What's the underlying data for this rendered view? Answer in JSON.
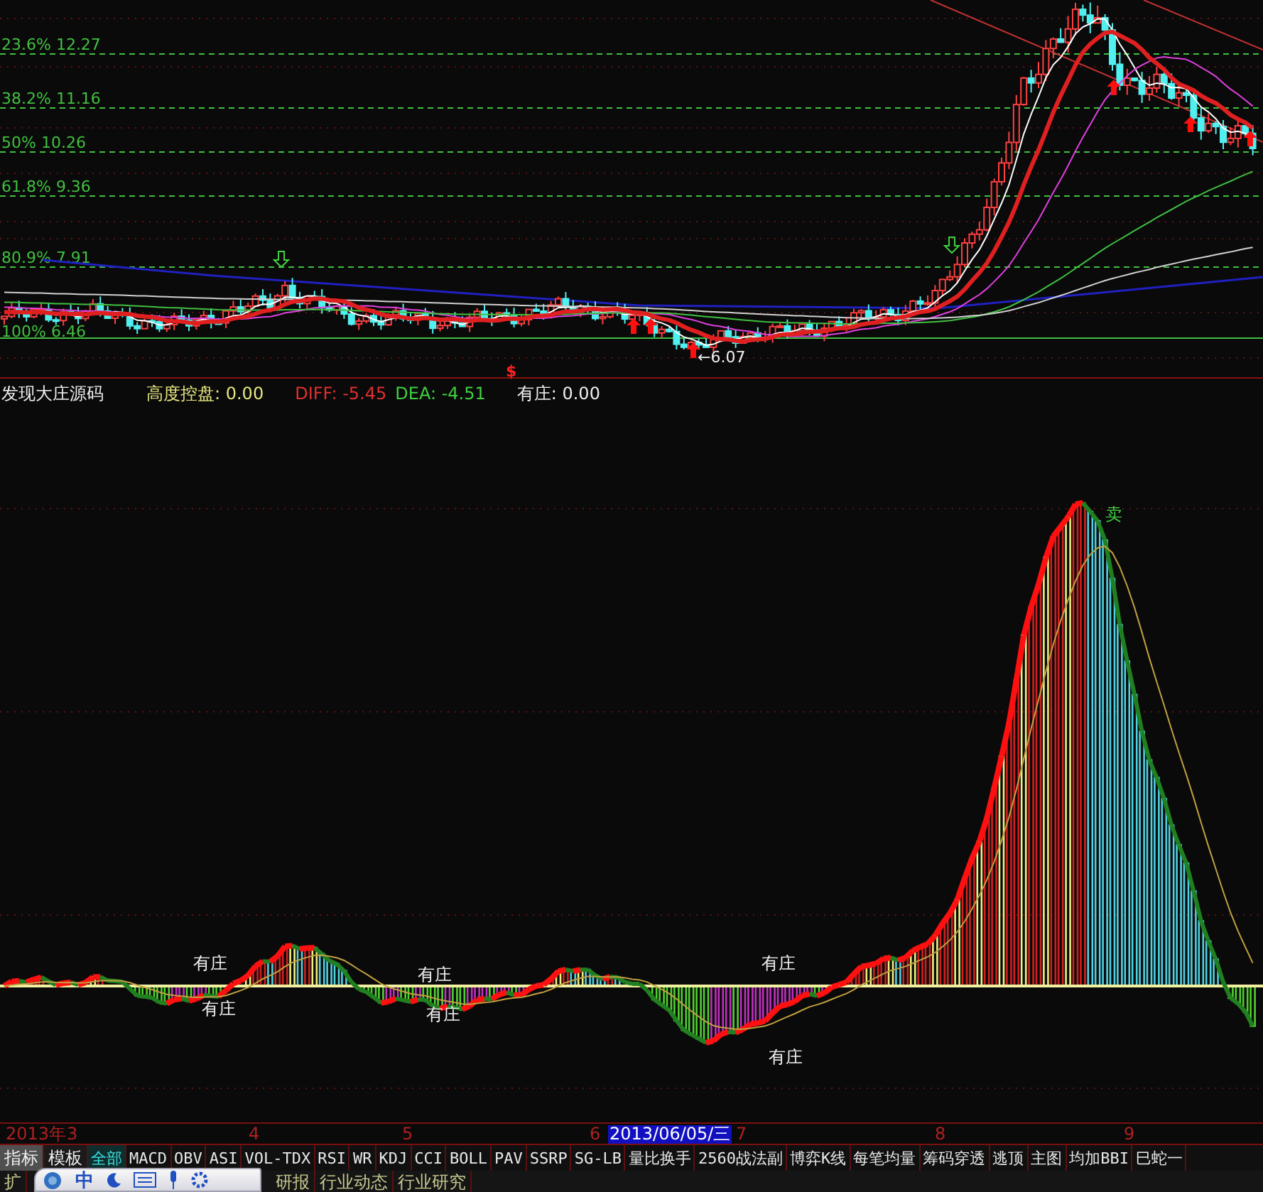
{
  "main_chart": {
    "fib_levels": [
      {
        "label": "23.6% 12.27"
      },
      {
        "label": "38.2% 11.16"
      },
      {
        "label": "50% 10.26"
      },
      {
        "label": "61.8% 9.36"
      },
      {
        "label": "80.9% 7.91"
      },
      {
        "label": "100% 6.46"
      }
    ],
    "low_label": "←6.07",
    "marker": "$"
  },
  "indicator": {
    "title": "发现大庄源码",
    "values": [
      {
        "text": "高度控盘: 0.00",
        "color": "#e8e880"
      },
      {
        "text": "DIFF: -5.45",
        "color": "#e03030"
      },
      {
        "text": "DEA: -4.51",
        "color": "#40d040"
      },
      {
        "text": "有庄: 0.00",
        "color": "#f0f0f0"
      }
    ],
    "annotations": [
      "有庄",
      "有庄",
      "有庄",
      "有庄",
      "有庄",
      "有庄"
    ],
    "sell_label": "卖"
  },
  "time_axis": [
    {
      "label": "2013年",
      "selected": false
    },
    {
      "label": "3",
      "selected": false
    },
    {
      "label": "4",
      "selected": false
    },
    {
      "label": "5",
      "selected": false
    },
    {
      "label": "6",
      "selected": false
    },
    {
      "label": "2013/06/05/三",
      "selected": true
    },
    {
      "label": "7",
      "selected": false
    },
    {
      "label": "8",
      "selected": false
    },
    {
      "label": "9",
      "selected": false
    }
  ],
  "toolbar_buttons": [
    {
      "label": "指标",
      "selected": true
    },
    {
      "label": "模板",
      "selected": false
    }
  ],
  "tabs": [
    {
      "label": "全部",
      "selected": true
    },
    {
      "label": "MACD",
      "selected": false
    },
    {
      "label": "OBV",
      "selected": false
    },
    {
      "label": "ASI",
      "selected": false
    },
    {
      "label": "VOL-TDX",
      "selected": false
    },
    {
      "label": "RSI",
      "selected": false
    },
    {
      "label": "WR",
      "selected": false
    },
    {
      "label": "KDJ",
      "selected": false
    },
    {
      "label": "CCI",
      "selected": false
    },
    {
      "label": "BOLL",
      "selected": false
    },
    {
      "label": "PAV",
      "selected": false
    },
    {
      "label": "SSRP",
      "selected": false
    },
    {
      "label": "SG-LB",
      "selected": false
    },
    {
      "label": "量比换手",
      "selected": false
    },
    {
      "label": "2560战法副",
      "selected": false
    },
    {
      "label": "博弈K线",
      "selected": false
    },
    {
      "label": "每笔均量",
      "selected": false
    },
    {
      "label": "筹码穿透",
      "selected": false
    },
    {
      "label": "逃顶",
      "selected": false
    },
    {
      "label": "主图",
      "selected": false
    },
    {
      "label": "均加BBI",
      "selected": false
    },
    {
      "label": "巳蛇一",
      "selected": false
    }
  ],
  "bottom_tabs": [
    "扩",
    "研报",
    "行业动态",
    "行业研究"
  ],
  "ime_toolbar": {
    "label": "中"
  }
}
